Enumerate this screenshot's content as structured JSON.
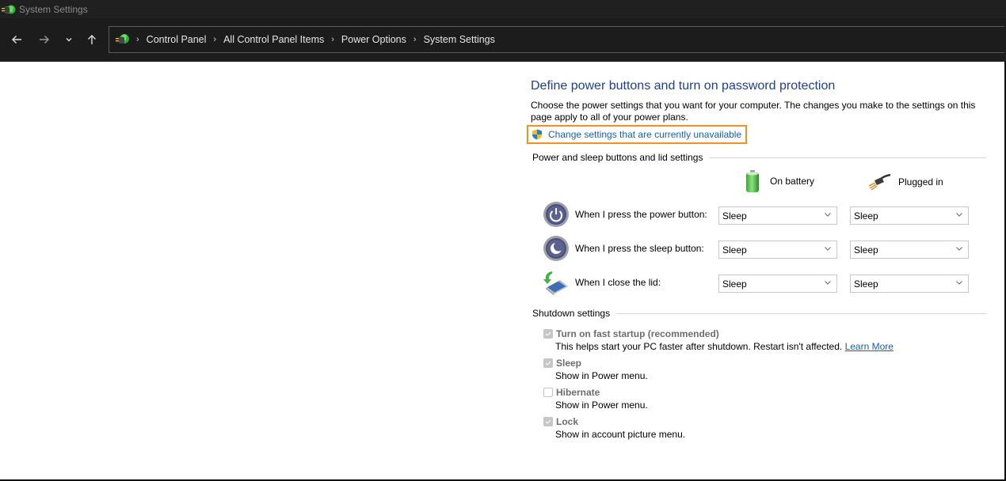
{
  "window": {
    "title": "System Settings"
  },
  "nav": {
    "back_icon": "arrow-left-icon",
    "forward_icon": "arrow-right-icon",
    "recent_icon": "chevron-down-icon",
    "up_icon": "arrow-up-icon",
    "breadcrumb": [
      "Control Panel",
      "All Control Panel Items",
      "Power Options",
      "System Settings"
    ],
    "separator": "›"
  },
  "main": {
    "heading": "Define power buttons and turn on password protection",
    "description": "Choose the power settings that you want for your computer. The changes you make to the settings on this page apply to all of your power plans.",
    "uac_link": "Change settings that are currently unavailable",
    "colors": {
      "heading": "#1e3f96",
      "link": "#1a5fb4",
      "highlight_border": "#f5901e"
    }
  },
  "power_section": {
    "title": "Power and sleep buttons and lid settings",
    "columns": [
      {
        "label": "On battery",
        "icon": "battery-icon"
      },
      {
        "label": "Plugged in",
        "icon": "power-plug-icon"
      }
    ],
    "rows": [
      {
        "label": "When I press the power button:",
        "icon": "power-button-icon",
        "on_battery": "Sleep",
        "plugged_in": "Sleep"
      },
      {
        "label": "When I press the sleep button:",
        "icon": "sleep-button-icon",
        "on_battery": "Sleep",
        "plugged_in": "Sleep"
      },
      {
        "label": "When I close the lid:",
        "icon": "laptop-lid-icon",
        "on_battery": "Sleep",
        "plugged_in": "Sleep"
      }
    ]
  },
  "shutdown_section": {
    "title": "Shutdown settings",
    "items": [
      {
        "label": "Turn on fast startup (recommended)",
        "description": "This helps start your PC faster after shutdown. Restart isn't affected.",
        "link": "Learn More",
        "checked": true,
        "disabled": true
      },
      {
        "label": "Sleep",
        "description": "Show in Power menu.",
        "checked": true,
        "disabled": true
      },
      {
        "label": "Hibernate",
        "description": "Show in Power menu.",
        "checked": false,
        "disabled": true
      },
      {
        "label": "Lock",
        "description": "Show in account picture menu.",
        "checked": true,
        "disabled": true
      }
    ]
  }
}
